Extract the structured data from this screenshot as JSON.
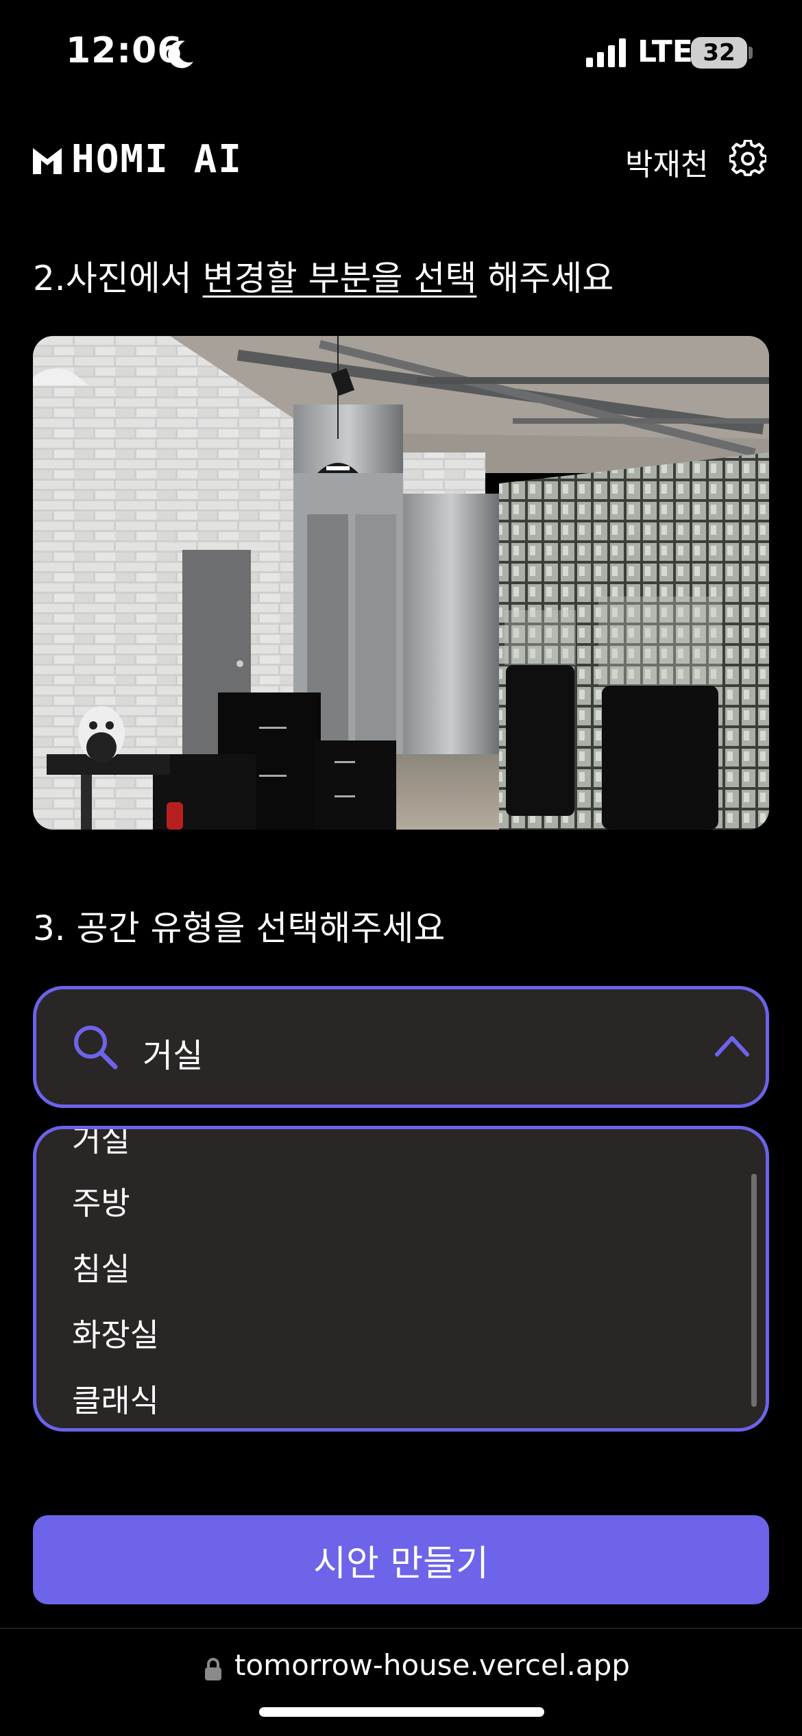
{
  "status_bar": {
    "time": "12:06",
    "network": "LTE",
    "battery": "32"
  },
  "header": {
    "logo": "HOMI AI",
    "user_name": "박재천"
  },
  "step2": {
    "prefix": "2.사진에서 ",
    "highlight": "변경할 부분을 선택",
    "suffix": " 해주세요"
  },
  "photo": {
    "description_icon": "photo-image"
  },
  "step3": {
    "title": "3. 공간 유형을 선택해주세요"
  },
  "select": {
    "value": "거실",
    "options": [
      "거실",
      "주방",
      "침실",
      "화장실",
      "클래식"
    ]
  },
  "primary_button": {
    "label": "시안 만들기"
  },
  "browser": {
    "url": "tomorrow-house.vercel.app"
  },
  "colors": {
    "accent": "#6d64ea",
    "surface": "#2a2626",
    "background": "#000000"
  }
}
